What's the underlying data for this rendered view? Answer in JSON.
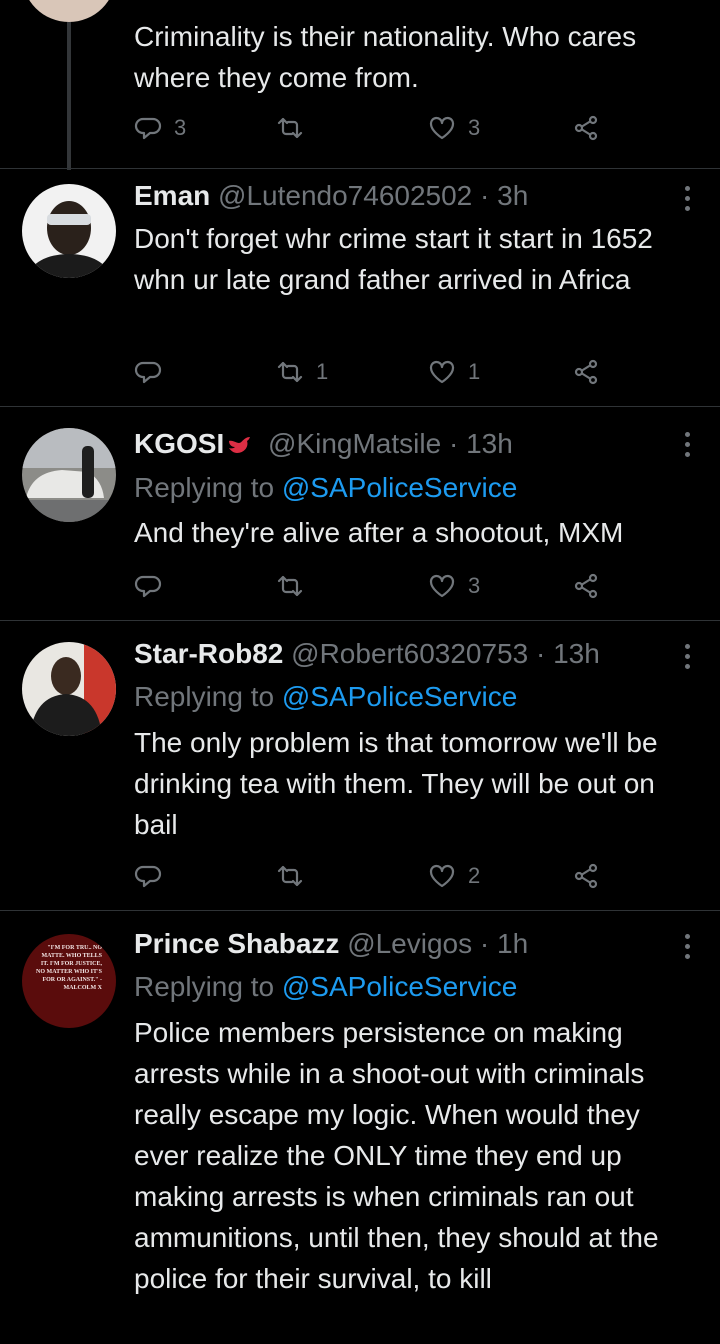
{
  "tweets": [
    {
      "text": "Criminality is their nationality. Who cares where they come from.",
      "replies": "3",
      "retweets": "",
      "likes": "3"
    },
    {
      "name": "Eman",
      "handle": "@Lutendo74602502",
      "time": "3h",
      "text": "Don't forget whr crime start it start in 1652 whn ur late grand father arrived in Africa",
      "replies": "",
      "retweets": "1",
      "likes": "1"
    },
    {
      "name": "KGOSI",
      "handle": "@KingMatsile",
      "time": "13h",
      "reply_prefix": "Replying to",
      "reply_to": "@SAPoliceService",
      "text": "And they're alive after a shootout, MXM",
      "replies": "",
      "retweets": "",
      "likes": "3"
    },
    {
      "name": "Star-Rob82",
      "handle": "@Robert60320753",
      "time": "13h",
      "reply_prefix": "Replying to",
      "reply_to": "@SAPoliceService",
      "text": "The only problem is that tomorrow we'll be drinking tea with them. They will be out on bail",
      "replies": "",
      "retweets": "",
      "likes": "2"
    },
    {
      "name": "Prince Shabazz",
      "handle": "@Levigos",
      "time": "1h",
      "reply_prefix": "Replying to",
      "reply_to": "@SAPoliceService",
      "text": "Police members persistence on making arrests while in a shoot-out with criminals really escape my logic. When would they ever realize the ONLY time they end up making arrests is when criminals ran out ammunitions, until then, they should at the police for their survival, to kill",
      "avatar_text": "\"I'M FOR TRU.. NO MATTE. WHO TELLS IT. I'M FOR JUSTICE, NO MATTER WHO IT'S FOR OR AGAINST.\" -MALCOLM X"
    }
  ],
  "dot": "·",
  "colors": {
    "background": "#000000",
    "text": "#e7e9ea",
    "muted": "#71767b",
    "link": "#1d9bf0",
    "separator": "#2f3336"
  },
  "icons": [
    "reply-icon",
    "retweet-icon",
    "like-icon",
    "share-icon",
    "more-icon",
    "bird-emoji-icon"
  ]
}
